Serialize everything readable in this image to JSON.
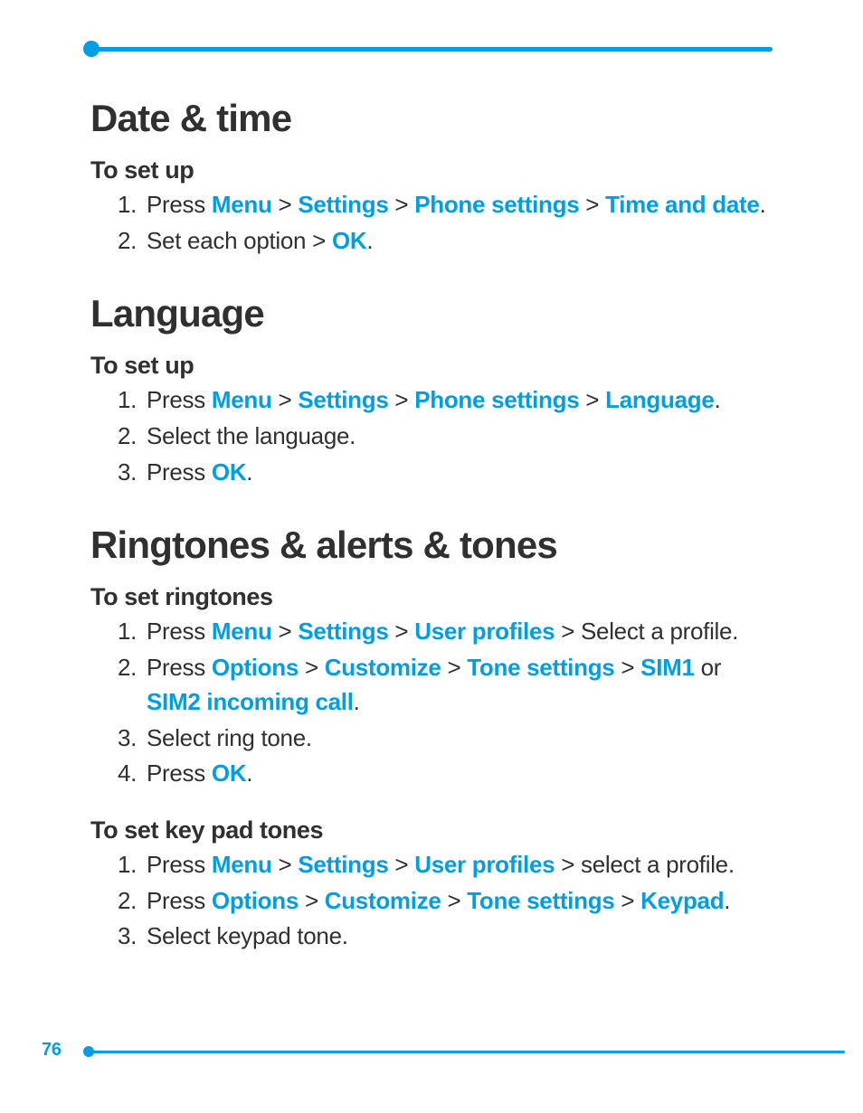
{
  "page_number": "76",
  "colors": {
    "accent": "#009fe3"
  },
  "sections": [
    {
      "heading": "Date & time",
      "subsections": [
        {
          "subheading": "To set up",
          "steps": [
            [
              {
                "t": "Press "
              },
              {
                "t": "Menu",
                "a": true
              },
              {
                "t": " > "
              },
              {
                "t": "Settings",
                "a": true
              },
              {
                "t": " > "
              },
              {
                "t": "Phone settings",
                "a": true
              },
              {
                "t": " > "
              },
              {
                "t": "Time and date",
                "a": true
              },
              {
                "t": "."
              }
            ],
            [
              {
                "t": "Set each option > "
              },
              {
                "t": "OK",
                "a": true
              },
              {
                "t": "."
              }
            ]
          ]
        }
      ]
    },
    {
      "heading": "Language",
      "subsections": [
        {
          "subheading": "To set up",
          "steps": [
            [
              {
                "t": "Press "
              },
              {
                "t": "Menu",
                "a": true
              },
              {
                "t": " > "
              },
              {
                "t": "Settings",
                "a": true
              },
              {
                "t": " > "
              },
              {
                "t": "Phone settings",
                "a": true
              },
              {
                "t": " > "
              },
              {
                "t": "Language",
                "a": true
              },
              {
                "t": "."
              }
            ],
            [
              {
                "t": "Select the language."
              }
            ],
            [
              {
                "t": "Press "
              },
              {
                "t": "OK",
                "a": true
              },
              {
                "t": "."
              }
            ]
          ]
        }
      ]
    },
    {
      "heading": "Ringtones & alerts & tones",
      "subsections": [
        {
          "subheading": "To set ringtones",
          "steps": [
            [
              {
                "t": "Press "
              },
              {
                "t": "Menu",
                "a": true
              },
              {
                "t": " > "
              },
              {
                "t": "Settings",
                "a": true
              },
              {
                "t": " > "
              },
              {
                "t": "User profiles",
                "a": true
              },
              {
                "t": " > Select a profile."
              }
            ],
            [
              {
                "t": "Press "
              },
              {
                "t": "Options",
                "a": true
              },
              {
                "t": " > "
              },
              {
                "t": "Customize",
                "a": true
              },
              {
                "t": " > "
              },
              {
                "t": "Tone settings",
                "a": true
              },
              {
                "t": " > "
              },
              {
                "t": "SIM1",
                "a": true
              },
              {
                "t": " or "
              },
              {
                "t": "SIM2 incoming call",
                "a": true
              },
              {
                "t": "."
              }
            ],
            [
              {
                "t": "Select ring tone."
              }
            ],
            [
              {
                "t": "Press "
              },
              {
                "t": "OK",
                "a": true
              },
              {
                "t": "."
              }
            ]
          ]
        },
        {
          "subheading": "To set key pad tones",
          "steps": [
            [
              {
                "t": "Press "
              },
              {
                "t": "Menu",
                "a": true
              },
              {
                "t": " > "
              },
              {
                "t": "Settings",
                "a": true
              },
              {
                "t": " > "
              },
              {
                "t": "User profiles",
                "a": true
              },
              {
                "t": " > select a profile."
              }
            ],
            [
              {
                "t": "Press "
              },
              {
                "t": "Options",
                "a": true
              },
              {
                "t": " > "
              },
              {
                "t": "Customize",
                "a": true
              },
              {
                "t": " > "
              },
              {
                "t": "Tone settings",
                "a": true
              },
              {
                "t": " > "
              },
              {
                "t": "Keypad",
                "a": true
              },
              {
                "t": "."
              }
            ],
            [
              {
                "t": "Select keypad tone."
              }
            ]
          ]
        }
      ]
    }
  ]
}
